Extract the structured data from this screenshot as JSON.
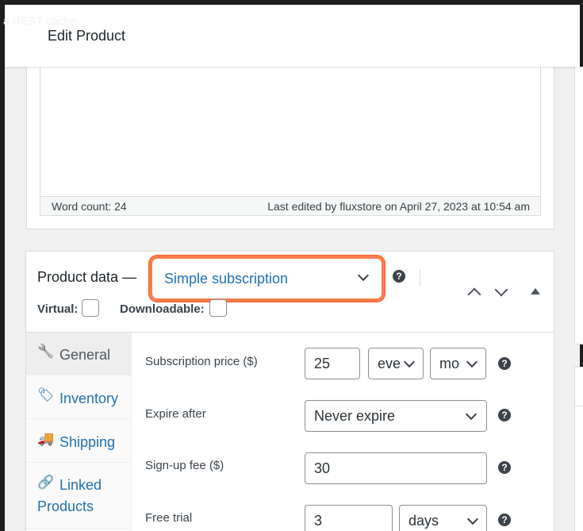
{
  "background_text": "a REST cache",
  "header": {
    "title": "Edit Product"
  },
  "editor": {
    "word_count": "Word count: 24",
    "last_edited": "Last edited by fluxstore on April 27, 2023 at 10:54 am"
  },
  "product_data": {
    "title": "Product data —",
    "type_select": {
      "value": "Simple subscription",
      "accent_color": "#fb7c4d",
      "text_color": "#2271b1"
    },
    "help_glyph": "?",
    "virtual_label": "Virtual:",
    "downloadable_label": "Downloadable:",
    "tabs": [
      {
        "label": "General",
        "icon": "wrench-icon",
        "glyph": "🔧",
        "active": true
      },
      {
        "label": "Inventory",
        "icon": "tag-icon",
        "glyph": "🏷",
        "active": false
      },
      {
        "label": "Shipping",
        "icon": "truck-icon",
        "glyph": "🚚",
        "active": false
      },
      {
        "label": "Linked",
        "label2": "Products",
        "icon": "link-icon",
        "glyph": "🔗",
        "active": false
      }
    ],
    "fields": {
      "subscription_price": {
        "label": "Subscription price ($)",
        "value": "25",
        "period_interval": "eve",
        "period_unit": "mo"
      },
      "expire_after": {
        "label": "Expire after",
        "value": "Never expire"
      },
      "signup_fee": {
        "label": "Sign-up fee ($)",
        "value": "30"
      },
      "free_trial": {
        "label": "Free trial",
        "value": "3",
        "unit": "days"
      }
    }
  }
}
